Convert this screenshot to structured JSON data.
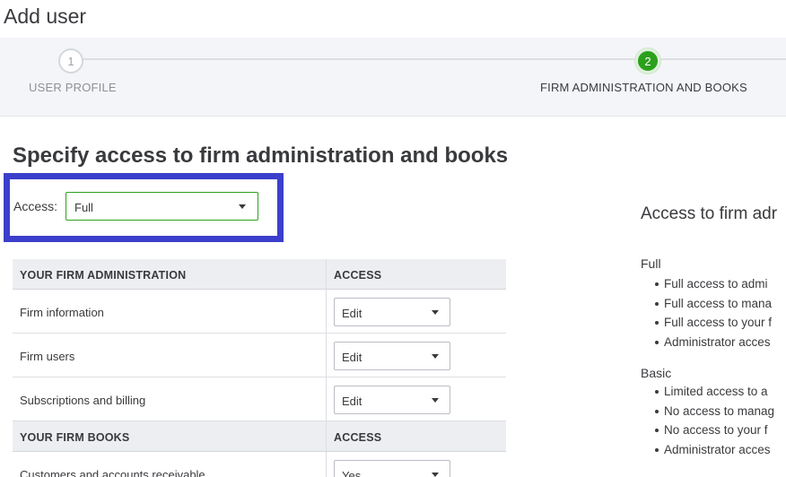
{
  "page": {
    "title": "Add user"
  },
  "stepper": {
    "steps": [
      {
        "number": "1",
        "label": "USER PROFILE"
      },
      {
        "number": "2",
        "label": "FIRM ADMINISTRATION AND BOOKS"
      }
    ]
  },
  "section": {
    "title": "Specify access to firm administration and books"
  },
  "access": {
    "label": "Access:",
    "value": "Full"
  },
  "admin_table": {
    "header": {
      "name": "YOUR FIRM ADMINISTRATION",
      "access": "ACCESS"
    },
    "rows": [
      {
        "name": "Firm information",
        "access": "Edit"
      },
      {
        "name": "Firm users",
        "access": "Edit"
      },
      {
        "name": "Subscriptions and billing",
        "access": "Edit"
      }
    ]
  },
  "books_table": {
    "header": {
      "name": "YOUR FIRM BOOKS",
      "access": "ACCESS"
    },
    "rows": [
      {
        "name": "Customers and accounts receivable",
        "access": "Yes"
      }
    ]
  },
  "right_panel": {
    "title": "Access to firm adr",
    "levels": [
      {
        "name": "Full",
        "items": [
          "Full access to admi",
          "Full access to mana",
          "Full access to your f",
          "Administrator acces"
        ]
      },
      {
        "name": "Basic",
        "items": [
          "Limited access to a",
          "No access to manag",
          "No access to your f",
          "Administrator acces"
        ]
      }
    ]
  },
  "colors": {
    "accent": "#2ca01c",
    "highlight": "#3b3fcb"
  },
  "icons": {
    "dropdown": "chevron-down-icon"
  }
}
